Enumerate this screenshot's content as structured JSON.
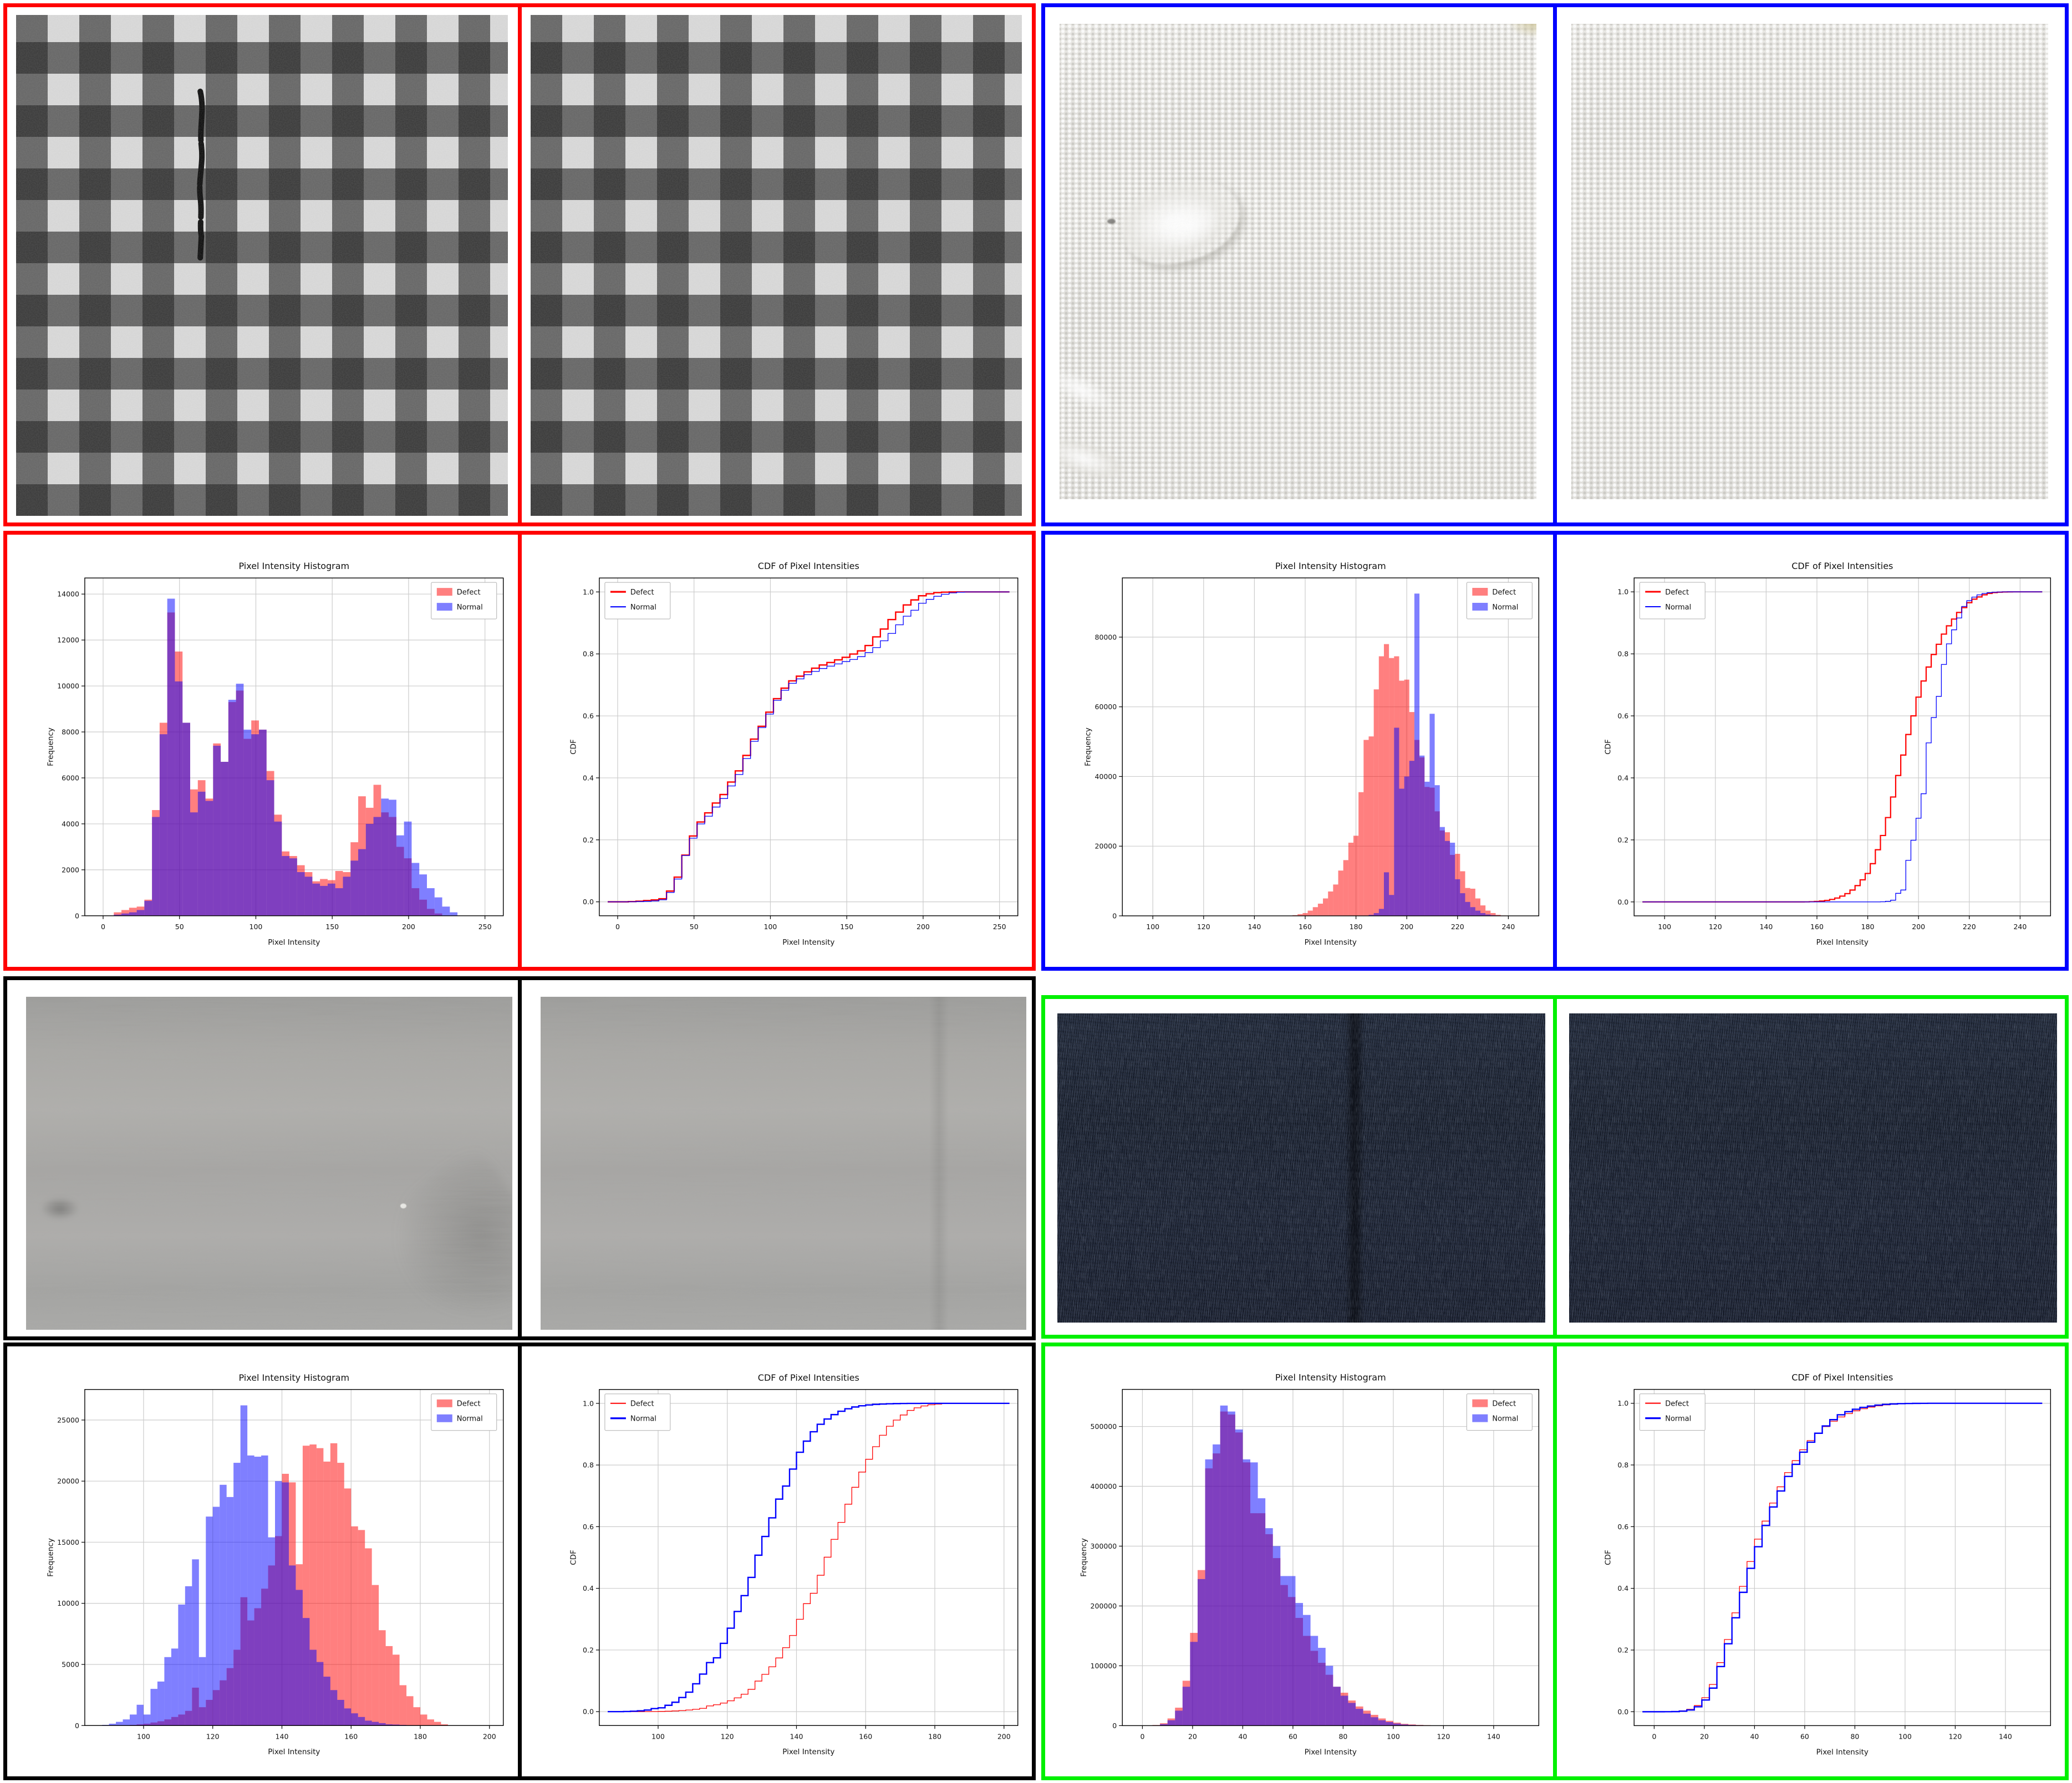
{
  "legend": {
    "defect": "Defect",
    "normal": "Normal"
  },
  "colors": {
    "hist_defect_fill": "rgba(255,0,0,0.5)",
    "hist_normal_fill": "rgba(0,0,255,0.5)",
    "cdf_defect_line": "#ff0000",
    "cdf_normal_line": "#0000ff",
    "grid": "#cccccc",
    "axis": "#000000",
    "panel_borders": {
      "red": "#ff0000",
      "blue": "#0000ff",
      "black": "#000000",
      "green": "#00f000"
    }
  },
  "chart_data": [
    {
      "panel": "red",
      "type": "bar",
      "fabric": "gingham-check",
      "bin_start": 2,
      "bin_width": 5,
      "xlim": [
        -12,
        262
      ],
      "xticks": [
        0,
        50,
        100,
        150,
        200,
        250
      ],
      "defect": [
        0,
        150,
        250,
        350,
        400,
        700,
        4600,
        8400,
        13200,
        11500,
        8400,
        5500,
        5900,
        5100,
        7500,
        6700,
        9300,
        9800,
        7700,
        8500,
        8100,
        6300,
        4400,
        2800,
        2600,
        2200,
        1900,
        1500,
        1600,
        1550,
        1950,
        1900,
        3200,
        5200,
        4700,
        5700,
        4500,
        4300,
        3000,
        2500,
        1200,
        700,
        300,
        100,
        0,
        0
      ],
      "normal": [
        0,
        50,
        100,
        150,
        250,
        650,
        4300,
        7900,
        13800,
        10200,
        8400,
        4500,
        5400,
        5000,
        7400,
        6700,
        9400,
        10100,
        8100,
        7900,
        8100,
        5900,
        4100,
        2600,
        2500,
        1900,
        1700,
        1400,
        1300,
        1400,
        1200,
        1700,
        2400,
        2900,
        4000,
        4300,
        5100,
        5050,
        3500,
        4100,
        2300,
        1800,
        1200,
        800,
        400,
        150
      ],
      "histogram": {
        "title": "Pixel Intensity Histogram",
        "xlabel": "Pixel Intensity",
        "ylabel": "Frequency",
        "yticks": [
          0,
          2000,
          4000,
          6000,
          8000,
          10000,
          12000,
          14000
        ],
        "ymax": 14700,
        "legend_loc": "upper right"
      },
      "cdf": {
        "title": "CDF of Pixel Intensities",
        "xlabel": "Pixel Intensity",
        "ylabel": "CDF",
        "yticks": [
          0,
          0.2,
          0.4,
          0.6,
          0.8,
          1
        ],
        "lw_defect": 2.4,
        "lw_normal": 1.3,
        "legend_loc": "upper left"
      }
    },
    {
      "panel": "blue",
      "type": "bar",
      "fabric": "white-weave",
      "bin_start": 155,
      "bin_width": 2,
      "xlim": [
        88,
        252
      ],
      "xticks": [
        100,
        120,
        140,
        160,
        180,
        200,
        220,
        240
      ],
      "defect": [
        200,
        500,
        800,
        1500,
        2500,
        3500,
        5000,
        7000,
        9000,
        13000,
        16000,
        21000,
        23000,
        35500,
        50500,
        51500,
        65000,
        74500,
        78000,
        74000,
        74500,
        67500,
        67800,
        58500,
        50500,
        45500,
        37000,
        36800,
        30000,
        24500,
        24000,
        17500,
        17800,
        12800,
        8000,
        7800,
        5000,
        3000,
        1500,
        800,
        300,
        100
      ],
      "normal": [
        0,
        0,
        0,
        0,
        0,
        0,
        0,
        0,
        0,
        0,
        0,
        0,
        0,
        0,
        0,
        300,
        800,
        2000,
        12500,
        6000,
        54000,
        36500,
        40000,
        44500,
        92500,
        46000,
        38500,
        58000,
        37500,
        25500,
        21500,
        21000,
        10500,
        6500,
        4000,
        2500,
        1500,
        800,
        400,
        200,
        100,
        0
      ],
      "histogram": {
        "title": "Pixel Intensity Histogram",
        "xlabel": "Pixel Intensity",
        "ylabel": "Frequency",
        "yticks": [
          0,
          20000,
          40000,
          60000,
          80000
        ],
        "ymax": 97000,
        "legend_loc": "upper right"
      },
      "cdf": {
        "title": "CDF of Pixel Intensities",
        "xlabel": "Pixel Intensity",
        "ylabel": "CDF",
        "yticks": [
          0,
          0.2,
          0.4,
          0.6,
          0.8,
          1
        ],
        "lw_defect": 2.2,
        "lw_normal": 1.3,
        "legend_loc": "upper left"
      }
    },
    {
      "panel": "black",
      "type": "bar",
      "fabric": "gray-cloth",
      "bin_start": 88,
      "bin_width": 2,
      "xlim": [
        83,
        204
      ],
      "xticks": [
        100,
        120,
        140,
        160,
        180,
        200
      ],
      "defect": [
        0,
        0,
        0,
        0,
        50,
        100,
        150,
        250,
        350,
        500,
        700,
        900,
        1200,
        3100,
        1500,
        2100,
        2900,
        3700,
        4700,
        6200,
        10500,
        8600,
        9600,
        11200,
        13100,
        15500,
        20600,
        19900,
        13200,
        22900,
        23000,
        22700,
        21600,
        23100,
        21500,
        19400,
        16300,
        16000,
        14500,
        11500,
        7800,
        6500,
        5800,
        3300,
        2400,
        1500,
        900,
        500,
        300,
        100
      ],
      "normal": [
        50,
        150,
        300,
        500,
        900,
        1700,
        900,
        3000,
        3600,
        5600,
        6300,
        9900,
        11400,
        13600,
        5600,
        17100,
        17900,
        19700,
        18700,
        21500,
        26200,
        22100,
        22000,
        22100,
        15400,
        20000,
        19900,
        13100,
        11100,
        8800,
        6200,
        5200,
        4000,
        2900,
        2100,
        1400,
        1000,
        700,
        400,
        300,
        200,
        100,
        80,
        50,
        30,
        20,
        10,
        0,
        0,
        0
      ],
      "histogram": {
        "title": "Pixel Intensity Histogram",
        "xlabel": "Pixel Intensity",
        "ylabel": "Frequency",
        "yticks": [
          0,
          5000,
          10000,
          15000,
          20000,
          25000
        ],
        "ymax": 27500,
        "legend_loc": "upper right"
      },
      "cdf": {
        "title": "CDF of Pixel Intensities",
        "xlabel": "Pixel Intensity",
        "ylabel": "CDF",
        "yticks": [
          0,
          0.2,
          0.4,
          0.6,
          0.8,
          1
        ],
        "lw_defect": 1.3,
        "lw_normal": 2.4,
        "legend_loc": "upper left"
      }
    },
    {
      "panel": "green",
      "type": "bar",
      "fabric": "denim",
      "bin_start": 4,
      "bin_width": 3,
      "xlim": [
        -8,
        158
      ],
      "xticks": [
        0,
        20,
        40,
        60,
        80,
        100,
        120,
        140
      ],
      "defect": [
        1000,
        4000,
        12000,
        30000,
        75000,
        155000,
        260000,
        430000,
        455000,
        525000,
        520000,
        490000,
        440000,
        355000,
        355000,
        320000,
        280000,
        235000,
        215000,
        180000,
        150000,
        125000,
        105000,
        85000,
        65000,
        55000,
        42000,
        32000,
        25000,
        18000,
        12000,
        8000,
        5000,
        3000,
        2000,
        1200,
        700,
        300
      ],
      "normal": [
        500,
        2500,
        9000,
        25000,
        65000,
        140000,
        245000,
        445000,
        470000,
        535000,
        525000,
        495000,
        445000,
        440000,
        380000,
        330000,
        300000,
        250000,
        250000,
        205000,
        185000,
        150000,
        130000,
        100000,
        65000,
        50000,
        38000,
        28000,
        20000,
        14000,
        9000,
        6000,
        3500,
        2000,
        1200,
        700,
        400,
        200
      ],
      "histogram": {
        "title": "Pixel Intensity Histogram",
        "xlabel": "Pixel Intensity",
        "ylabel": "Frequency",
        "yticks": [
          0,
          100000,
          200000,
          300000,
          400000,
          500000
        ],
        "ymax": 562000,
        "legend_loc": "upper right"
      },
      "cdf": {
        "title": "CDF of Pixel Intensities",
        "xlabel": "Pixel Intensity",
        "ylabel": "CDF",
        "yticks": [
          0,
          0.2,
          0.4,
          0.6,
          0.8,
          1
        ],
        "lw_defect": 1.3,
        "lw_normal": 2.4,
        "legend_loc": "upper left"
      }
    }
  ]
}
